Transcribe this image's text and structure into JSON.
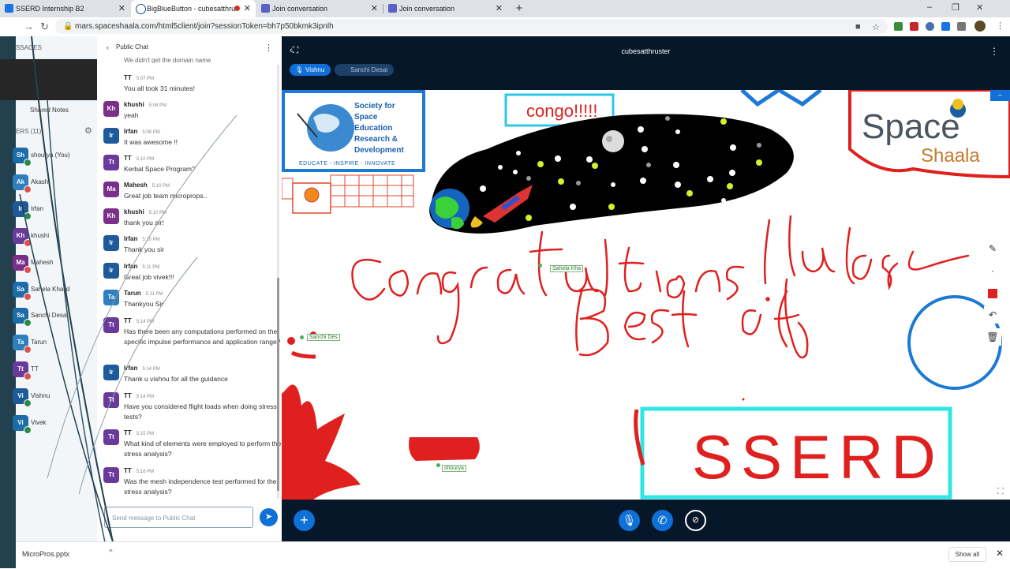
{
  "browser": {
    "tabs": [
      {
        "label": "SSERD Internship B2",
        "active": false
      },
      {
        "label": "BigBlueButton - cubesatthru",
        "active": true
      },
      {
        "label": "Join conversation",
        "active": false
      },
      {
        "label": "Join conversation",
        "active": false
      }
    ],
    "url": "mars.spaceshaala.com/html5client/join?sessionToken=bh7p50bkmk3ipnlh",
    "window_controls": {
      "minimize": "–",
      "restore": "❐",
      "close": "✕"
    }
  },
  "sidebar": {
    "messages_label": "SSAGES",
    "shared_notes": "Shared Notes",
    "users_label": "ERS (11)",
    "users": [
      {
        "initials": "Sh",
        "name": "shourya (You)",
        "color": "#1b6ca8",
        "status": "#2a8a4a"
      },
      {
        "initials": "Ak",
        "name": "Akash",
        "color": "#2d7fbd",
        "status": "#d9534f"
      },
      {
        "initials": "Ir",
        "name": "Irfan",
        "color": "#1e5a9a",
        "status": "#2a8a4a"
      },
      {
        "initials": "Kh",
        "name": "khushi",
        "color": "#6a3a9a",
        "status": "#d9534f"
      },
      {
        "initials": "Ma",
        "name": "Mahesh",
        "color": "#7a2f8a",
        "status": "#d9534f"
      },
      {
        "initials": "Sa",
        "name": "Sahela Khalid",
        "color": "#1b6ca8",
        "status": "#d9534f"
      },
      {
        "initials": "Sa",
        "name": "Sanchi Desai",
        "color": "#1b6ca8",
        "status": "#2a8a4a"
      },
      {
        "initials": "Ta",
        "name": "Tarun",
        "color": "#2d7fbd",
        "status": "#d9534f"
      },
      {
        "initials": "Tt",
        "name": "TT",
        "color": "#6a3a9a",
        "status": "#d9534f"
      },
      {
        "initials": "Vi",
        "name": "Vishnu",
        "color": "#1e5a9a",
        "status": "#2a8a4a"
      },
      {
        "initials": "Vi",
        "name": "Vivek",
        "color": "#1b6ca8",
        "status": "#2a8a4a"
      }
    ]
  },
  "chat": {
    "title": "Public Chat",
    "top_partial": "We didn't get the domain name",
    "messages": [
      {
        "initials": "Tt",
        "color": "#6a3a9a",
        "name": "TT",
        "time": "5:07 PM",
        "text": "You all took 31 minutes!"
      },
      {
        "initials": "Kh",
        "color": "#7a2f8a",
        "name": "khushi",
        "time": "5:08 PM",
        "text": "yeah"
      },
      {
        "initials": "Ir",
        "color": "#1e5a9a",
        "name": "Irfan",
        "time": "5:08 PM",
        "text": "It was awesome !!"
      },
      {
        "initials": "Tt",
        "color": "#6a3a9a",
        "name": "TT",
        "time": "5:10 PM",
        "text": "Kerbal Space Program?"
      },
      {
        "initials": "Ma",
        "color": "#7a2f8a",
        "name": "Mahesh",
        "time": "5:10 PM",
        "text": "Great job team microprops.."
      },
      {
        "initials": "Kh",
        "color": "#7a2f8a",
        "name": "khushi",
        "time": "5:10 PM",
        "text": "thank you sir!"
      },
      {
        "initials": "Ir",
        "color": "#1e5a9a",
        "name": "Irfan",
        "time": "5:10 PM",
        "text": "Thank you sir"
      },
      {
        "initials": "Ir",
        "color": "#1e5a9a",
        "name": "Irfan",
        "time": "5:11 PM",
        "text": "Great job vivek!!!"
      },
      {
        "initials": "Ta",
        "color": "#2d7fbd",
        "name": "Tarun",
        "time": "5:11 PM",
        "text": "Thankyou Sir"
      },
      {
        "initials": "Tt",
        "color": "#6a3a9a",
        "name": "TT",
        "time": "5:14 PM",
        "text": "Has there been any computations performed on the specific impulse performance and application range?"
      },
      {
        "initials": "Ir",
        "color": "#1e5a9a",
        "name": "Irfan",
        "time": "5:14 PM",
        "text": "Thank u vishnu for all the guidance"
      },
      {
        "initials": "Tt",
        "color": "#6a3a9a",
        "name": "TT",
        "time": "5:14 PM",
        "text": "Have you considered flight loads when doing stress tests?"
      },
      {
        "initials": "Tt",
        "color": "#6a3a9a",
        "name": "TT",
        "time": "5:15 PM",
        "text": "What kind of elements were employed to perform the stress analysis?"
      },
      {
        "initials": "Tt",
        "color": "#6a3a9a",
        "name": "TT",
        "time": "5:16 PM",
        "text": "Was the mesh independence test performed for the stress analysis?"
      }
    ],
    "input_placeholder": "Send message to Public Chat"
  },
  "stage": {
    "meeting_title": "cubesatthruster",
    "talkers": [
      {
        "name": "Vishnu",
        "active": true
      },
      {
        "name": "Sanchi Desai",
        "active": false
      }
    ],
    "whiteboard": {
      "logo_org": [
        "Society for",
        "Space",
        "Education",
        "Research &",
        "Development"
      ],
      "logo_tagline": "EDUCATE - INSPIRE - INNOVATE",
      "congo_text": "congo!!!!!",
      "sserd_text": "SSERD",
      "brand_top": "Space",
      "brand_bottom": "Shaala",
      "handwriting_1": "Congratulations!! Best of luck",
      "cursors": [
        "Sahela Kha",
        "Sanchi Des",
        "shourya"
      ]
    }
  },
  "downloads": {
    "file": "MicroPros.pptx",
    "show_all": "Show all"
  }
}
